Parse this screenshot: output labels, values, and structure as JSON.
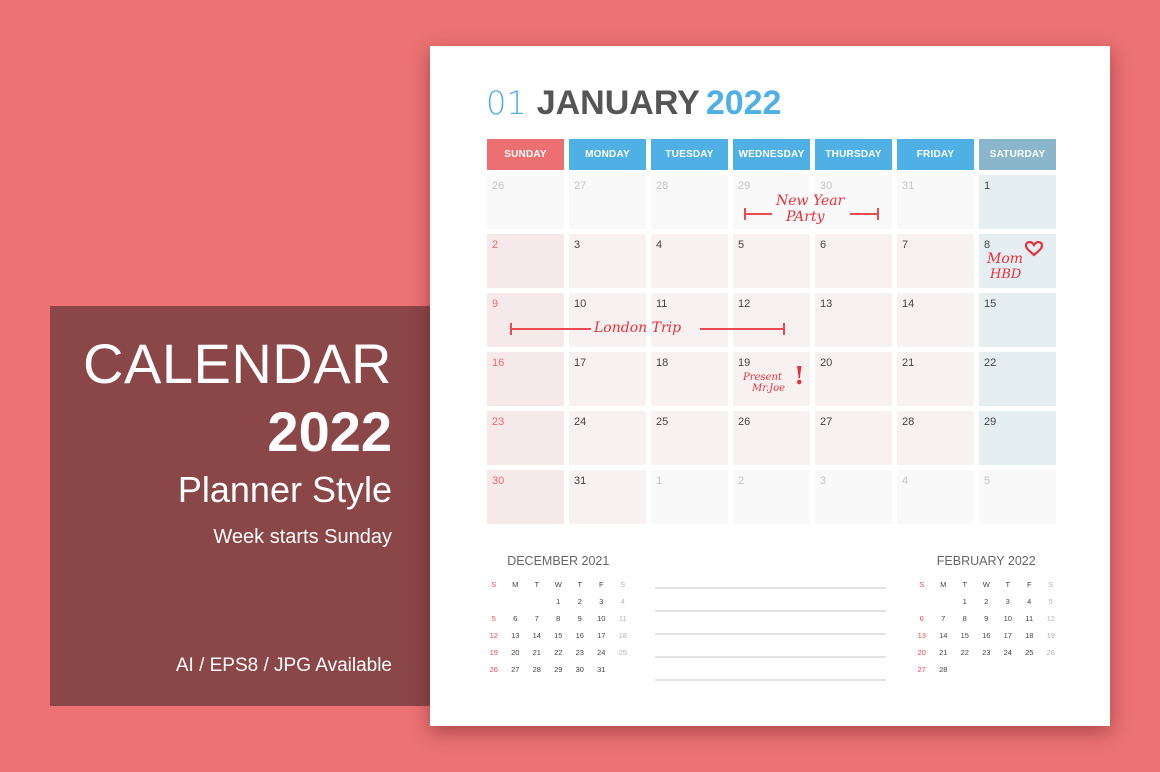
{
  "colors": {
    "background": "#ec7273",
    "panel": "#8b4647",
    "accent_blue": "#4fb0e6",
    "sunday_red": "#ec6a6b",
    "saturday_header": "#8ab6cc",
    "note_red": "#e8303a"
  },
  "promo": {
    "title": "CALENDAR",
    "year": "2022",
    "style": "Planner Style",
    "week_start": "Week starts Sunday",
    "formats": "AI / EPS8 / JPG  Available"
  },
  "calendar": {
    "month_number": "01",
    "month_name": "JANUARY",
    "year": "2022",
    "weekdays": [
      {
        "label": "SUNDAY",
        "color": "#ec6f71"
      },
      {
        "label": "MONDAY",
        "color": "#4fb0e6"
      },
      {
        "label": "TUESDAY",
        "color": "#4fb0e6"
      },
      {
        "label": "WEDNESDAY",
        "color": "#4fb0e6"
      },
      {
        "label": "THURSDAY",
        "color": "#4fb0e6"
      },
      {
        "label": "FRIDAY",
        "color": "#4fb0e6"
      },
      {
        "label": "SATURDAY",
        "color": "#8ab6cc"
      }
    ],
    "weeks": [
      [
        {
          "d": "26",
          "t": "other"
        },
        {
          "d": "27",
          "t": "other"
        },
        {
          "d": "28",
          "t": "other"
        },
        {
          "d": "29",
          "t": "other"
        },
        {
          "d": "30",
          "t": "other"
        },
        {
          "d": "31",
          "t": "other"
        },
        {
          "d": "1",
          "t": "sat"
        }
      ],
      [
        {
          "d": "2",
          "t": "sun"
        },
        {
          "d": "3",
          "t": "week"
        },
        {
          "d": "4",
          "t": "week"
        },
        {
          "d": "5",
          "t": "week"
        },
        {
          "d": "6",
          "t": "week"
        },
        {
          "d": "7",
          "t": "week"
        },
        {
          "d": "8",
          "t": "sat"
        }
      ],
      [
        {
          "d": "9",
          "t": "sun"
        },
        {
          "d": "10",
          "t": "week"
        },
        {
          "d": "11",
          "t": "week"
        },
        {
          "d": "12",
          "t": "week"
        },
        {
          "d": "13",
          "t": "week"
        },
        {
          "d": "14",
          "t": "week"
        },
        {
          "d": "15",
          "t": "sat"
        }
      ],
      [
        {
          "d": "16",
          "t": "sun"
        },
        {
          "d": "17",
          "t": "week"
        },
        {
          "d": "18",
          "t": "week"
        },
        {
          "d": "19",
          "t": "week"
        },
        {
          "d": "20",
          "t": "week"
        },
        {
          "d": "21",
          "t": "week"
        },
        {
          "d": "22",
          "t": "sat"
        }
      ],
      [
        {
          "d": "23",
          "t": "sun"
        },
        {
          "d": "24",
          "t": "week"
        },
        {
          "d": "25",
          "t": "week"
        },
        {
          "d": "26",
          "t": "week"
        },
        {
          "d": "27",
          "t": "week"
        },
        {
          "d": "28",
          "t": "week"
        },
        {
          "d": "29",
          "t": "sat"
        }
      ],
      [
        {
          "d": "30",
          "t": "sun"
        },
        {
          "d": "31",
          "t": "week"
        },
        {
          "d": "1",
          "t": "other"
        },
        {
          "d": "2",
          "t": "other"
        },
        {
          "d": "3",
          "t": "other"
        },
        {
          "d": "4",
          "t": "other"
        },
        {
          "d": "5",
          "t": "other"
        }
      ]
    ],
    "notes": {
      "new_year_line1": "New Year",
      "new_year_line2": "PArty",
      "mom_line1": "Mom",
      "mom_line2": "HBD",
      "heart_icon": "heart-icon",
      "london": "London Trip",
      "present_line1": "Present",
      "present_line2": "Mr.Joe",
      "exclaim": "!"
    }
  },
  "mini_calendars": [
    {
      "title": "DECEMBER 2021",
      "weekdays": [
        "S",
        "M",
        "T",
        "W",
        "T",
        "F",
        "S"
      ],
      "days": [
        "",
        "",
        "",
        "1",
        "2",
        "3",
        "4",
        "5",
        "6",
        "7",
        "8",
        "9",
        "10",
        "11",
        "12",
        "13",
        "14",
        "15",
        "16",
        "17",
        "18",
        "19",
        "20",
        "21",
        "22",
        "23",
        "24",
        "25",
        "26",
        "27",
        "28",
        "29",
        "30",
        "31",
        ""
      ]
    },
    {
      "title": "FEBRUARY 2022",
      "weekdays": [
        "S",
        "M",
        "T",
        "W",
        "T",
        "F",
        "S"
      ],
      "days": [
        "",
        "",
        "1",
        "2",
        "3",
        "4",
        "5",
        "6",
        "7",
        "8",
        "9",
        "10",
        "11",
        "12",
        "13",
        "14",
        "15",
        "16",
        "17",
        "18",
        "19",
        "20",
        "21",
        "22",
        "23",
        "24",
        "25",
        "26",
        "27",
        "28",
        "",
        "",
        "",
        "",
        ""
      ]
    }
  ],
  "note_lines_count": 5
}
